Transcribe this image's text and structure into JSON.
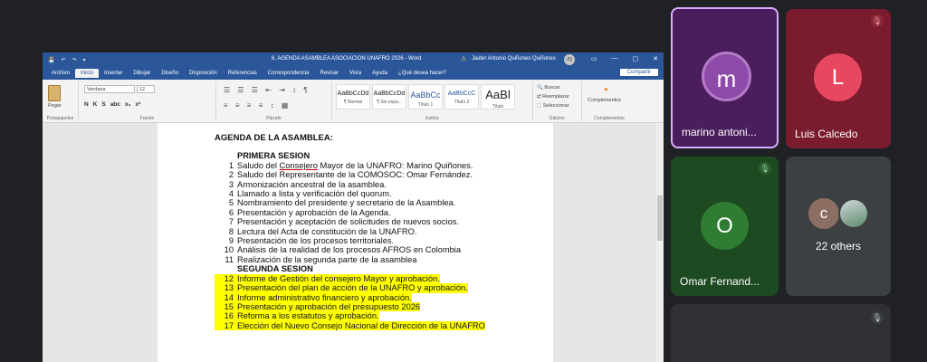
{
  "word": {
    "qat": [
      "💾",
      "↶",
      "↷",
      "▾"
    ],
    "title": "6. AGENDA ASAMBLEA ASOCIACION  UNAFRO 2026  -  Word",
    "user": "Jaider Antonio Quiñones Quiñones",
    "user_initials": "JQ",
    "window_controls": [
      "▭",
      "—",
      "▢",
      "✕"
    ],
    "tabs": [
      "Archivo",
      "Inicio",
      "Insertar",
      "Dibujar",
      "Diseño",
      "Disposición",
      "Referencias",
      "Correspondencia",
      "Revisar",
      "Vista",
      "Ayuda",
      "¿Qué desea hacer?"
    ],
    "active_tab": "Inicio",
    "share_label": "Compartir",
    "ribbon": {
      "paste_label": "Pegar",
      "font_name": "Verdana",
      "font_size": "12",
      "format_buttons": [
        "N",
        "K",
        "S",
        "abc",
        "x₂",
        "x²"
      ],
      "styles": [
        {
          "preview": "AaBbCcDd",
          "name": "¶ Normal"
        },
        {
          "preview": "AaBbCcDd",
          "name": "¶ Sin espa..."
        },
        {
          "preview": "AaBbCc",
          "name": "Título 1"
        },
        {
          "preview": "AaBbCcC",
          "name": "Título 2"
        },
        {
          "preview": "AaBl",
          "name": "Título"
        }
      ],
      "edit": [
        "Buscar",
        "Reemplazar",
        "Seleccionar"
      ],
      "complementos": "Complementos",
      "groups": [
        "Portapapeles",
        "Fuente",
        "Párrafo",
        "Estilos",
        "Edición",
        "Complementos"
      ]
    }
  },
  "document": {
    "heading": "AGENDA DE LA ASAMBLEA:",
    "section1": "PRIMERA SESION",
    "items1": [
      {
        "n": "1",
        "pre": "Saludo del ",
        "u": "Consejero",
        "post": " Mayor de la UNAFRO: Marino Quiñones."
      },
      {
        "n": "2",
        "text": "Saludo del Representante de la COMOSOC: Omar Fernández."
      },
      {
        "n": "3",
        "text": "Armonización ancestral de la asamblea."
      },
      {
        "n": "4",
        "text": "Llamado a lista y verificación del quorum."
      },
      {
        "n": "5",
        "text": "Nombramiento del presidente y secretario de la Asamblea."
      },
      {
        "n": "6",
        "text": "Presentación y aprobación de la Agenda."
      },
      {
        "n": "7",
        "text": "Presentación y aceptación de solicitudes de nuevos socios."
      },
      {
        "n": "8",
        "text": "Lectura del Acta de constitución de la UNAFRO."
      },
      {
        "n": "9",
        "text": "Presentación de los procesos territoriales."
      },
      {
        "n": "10",
        "text": "Análisis de la realidad de los procesos AFROS en Colombia"
      },
      {
        "n": "11",
        "text": "Realización de la segunda parte de la asamblea"
      }
    ],
    "section2": "SEGUNDA SESION",
    "items2": [
      {
        "n": "12",
        "text": "Informe de Gestión del consejero Mayor y aprobación."
      },
      {
        "n": "13",
        "text": "Presentación del plan de acción de la UNAFRO y aprobación."
      },
      {
        "n": "14",
        "text": "Informe administrativo financiero y aprobación."
      },
      {
        "n": "15",
        "text": "Presentación y aprobación del presupuesto 2026"
      },
      {
        "n": "16",
        "text": "Reforma a los estatutos y aprobación."
      },
      {
        "n": "17",
        "text": "Elección del Nuevo Consejo Nacional de Dirección de la UNAFRO"
      }
    ]
  },
  "participants": [
    {
      "name": "marino antoni...",
      "initial": "m",
      "bg": "#4a1d5c",
      "avatar": "#8e4aa8",
      "speaking": true
    },
    {
      "name": "Luis Calcedo",
      "initial": "L",
      "bg": "#7a1c2e",
      "avatar": "#e8485f",
      "muted": true
    },
    {
      "name": "Omar Fernand...",
      "initial": "O",
      "bg": "#1e4a22",
      "avatar": "#2e7d32",
      "muted": true
    },
    {
      "name": "22 others",
      "initial": "c",
      "bg": "#3c4043",
      "avatar": "#8d6e63"
    }
  ],
  "colors": {
    "word_blue": "#2b579a",
    "highlight": "#ffff00",
    "meet_bg": "#202124"
  },
  "icons": {
    "mic_off": "mic-off-icon"
  }
}
